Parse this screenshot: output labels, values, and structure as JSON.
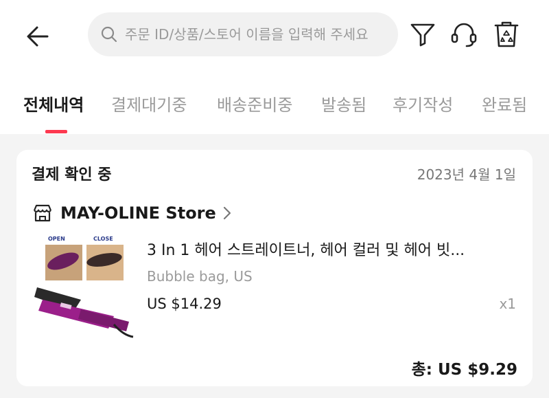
{
  "search": {
    "placeholder": "주문 ID/상품/스토어 이름을 입력해 주세요",
    "value": ""
  },
  "toolbar": {
    "back_icon": "back-arrow-icon",
    "filter_icon": "filter-icon",
    "support_icon": "headset-icon",
    "delete_icon": "recycle-bin-icon"
  },
  "tabs": [
    {
      "label": "전체내역",
      "active": true
    },
    {
      "label": "결제대기중"
    },
    {
      "label": "배송준비중"
    },
    {
      "label": "발송됨"
    },
    {
      "label": "후기작성"
    },
    {
      "label": "완료됨"
    }
  ],
  "order": {
    "status": "결제 확인 중",
    "date": "2023년 4월 1일",
    "store": {
      "name": "MAY-OLINE Store",
      "icon": "store-icon"
    },
    "item": {
      "name": "3 In 1 헤어 스트레이트너, 헤어 컬러 및 헤어 빗...",
      "variant": "Bubble bag, US",
      "price": "US $14.29",
      "quantity": "x1",
      "image_labels": {
        "open": "OPEN",
        "close": "CLOSE"
      }
    },
    "total": "총: US $9.29"
  },
  "colors": {
    "accent": "#fd384f",
    "background": "#f4f4f4",
    "text": "#191919",
    "muted": "#9a9a9a"
  }
}
